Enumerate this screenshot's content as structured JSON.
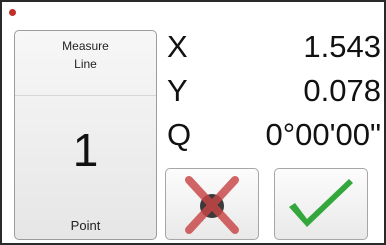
{
  "colors": {
    "status_dot": "#c0302a",
    "cancel_x": "#c94545",
    "cancel_circle": "#3a3a3a",
    "accept_check": "#33a63c"
  },
  "measure_panel": {
    "type_label": "Measure\nLine",
    "point_count": "1",
    "point_unit": "Point"
  },
  "readouts": [
    {
      "label": "X",
      "value": "1.543"
    },
    {
      "label": "Y",
      "value": "0.078"
    },
    {
      "label": "Q",
      "value": "0°00'00\""
    }
  ],
  "buttons": {
    "cancel_icon": "cancel-x-icon",
    "accept_icon": "checkmark-icon"
  }
}
